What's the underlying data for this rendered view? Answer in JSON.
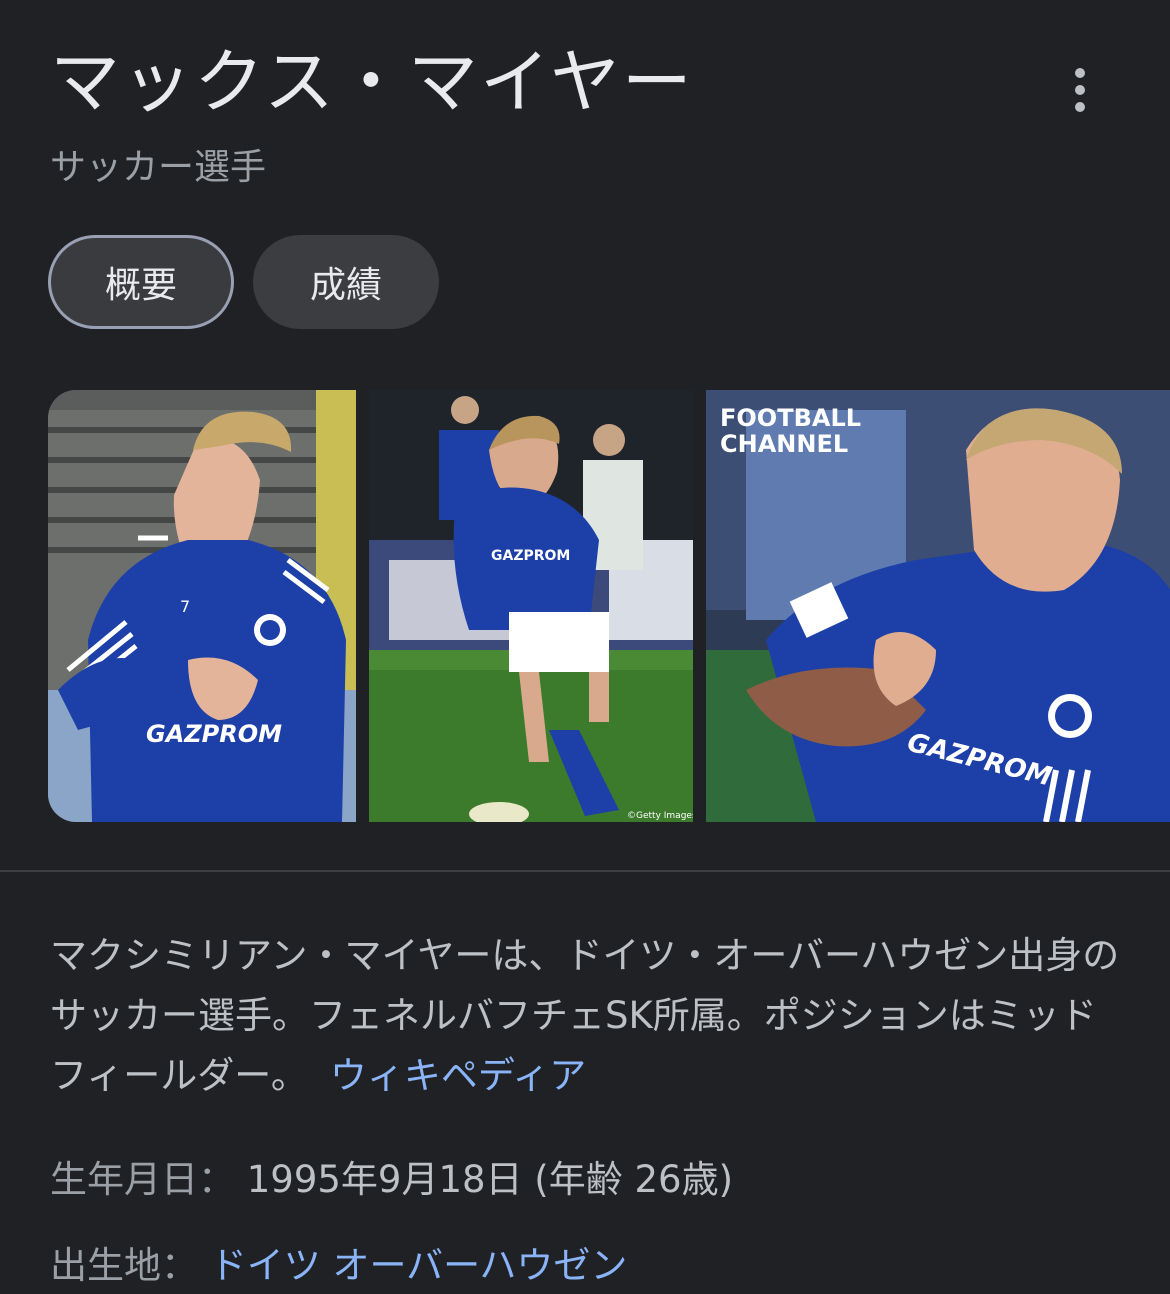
{
  "header": {
    "title": "マックス・マイヤー",
    "subtitle": "サッカー選手",
    "more_icon": "more-vert-icon"
  },
  "tabs": [
    {
      "label": "概要",
      "selected": true
    },
    {
      "label": "成績",
      "selected": false
    }
  ],
  "images": [
    {
      "jersey_number": "7",
      "sponsor": "GAZPROM"
    },
    {
      "sponsor": "GAZPROM",
      "credit": "©Getty Images"
    },
    {
      "watermark_line1": "FOOTBALL",
      "watermark_line2": "CHANNEL",
      "sponsor": "GAZPROM"
    }
  ],
  "description": {
    "text": "マクシミリアン・マイヤーは、ドイツ・オーバーハウゼン出身のサッカー選手。フェネルバフチェSK所属。ポジションはミッドフィールダー。",
    "source_link": "ウィキペディア"
  },
  "facts": {
    "birth": {
      "label": "生年月日： ",
      "value": "1995年9月18日 (年齢 26歳)"
    },
    "birthplace": {
      "label": "出生地： ",
      "value": "ドイツ オーバーハウゼン"
    }
  },
  "colors": {
    "background": "#202124",
    "text_primary": "#e8eaed",
    "text_secondary": "#9aa0a6",
    "link": "#8ab4f8",
    "chip_background": "#3c3d40",
    "schalke_blue": "#1c3fa8"
  }
}
